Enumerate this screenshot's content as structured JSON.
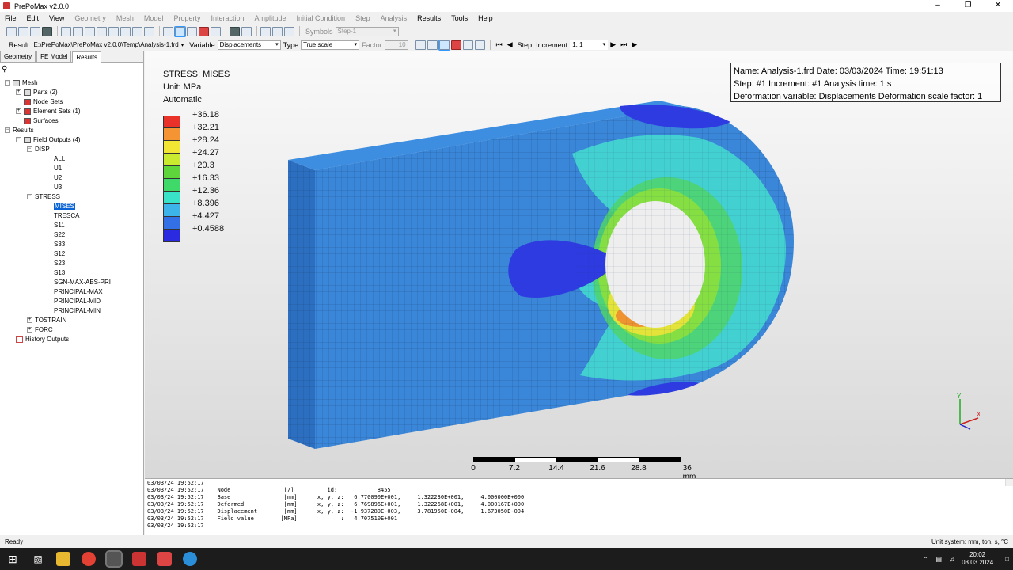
{
  "window": {
    "title": "PrePoMax v2.0.0"
  },
  "menu": [
    "File",
    "Edit",
    "View",
    "Geometry",
    "Mesh",
    "Model",
    "Property",
    "Interaction",
    "Amplitude",
    "Initial Condition",
    "Step",
    "Analysis",
    "Results",
    "Tools",
    "Help"
  ],
  "toolbar1": {
    "symbols_label": "Symbols",
    "step_value": "Step-1"
  },
  "toolbar2": {
    "result_label": "Result",
    "result_path": "E:\\PrePoMax\\PrePoMax v2.0.0\\Temp\\Analysis-1.frd",
    "variable_label": "Variable",
    "variable_value": "Displacements",
    "type_label": "Type",
    "type_value": "True scale",
    "factor_label": "Factor",
    "factor_value": "10",
    "step_increment_label": "Step, Increment",
    "step_increment_value": "1, 1"
  },
  "tabs": [
    "Geometry",
    "FE Model",
    "Results"
  ],
  "tree": {
    "mesh": "Mesh",
    "parts": "Parts (2)",
    "node_sets": "Node Sets",
    "element_sets": "Element Sets (1)",
    "surfaces": "Surfaces",
    "results": "Results",
    "field_outputs": "Field Outputs (4)",
    "disp": "DISP",
    "disp_items": [
      "ALL",
      "U1",
      "U2",
      "U3"
    ],
    "stress": "STRESS",
    "stress_items": [
      "MISES",
      "TRESCA",
      "S11",
      "S22",
      "S33",
      "S12",
      "S23",
      "S13",
      "SGN-MAX-ABS-PRI",
      "PRINCIPAL-MAX",
      "PRINCIPAL-MID",
      "PRINCIPAL-MIN"
    ],
    "tostrain": "TOSTRAIN",
    "forc": "FORC",
    "history_outputs": "History Outputs"
  },
  "legend": {
    "title": "STRESS: MISES",
    "unit": "Unit: MPa",
    "mode": "Automatic",
    "values": [
      "+36.18",
      "+32.21",
      "+28.24",
      "+24.27",
      "+20.3",
      "+16.33",
      "+12.36",
      "+8.396",
      "+4.427",
      "+0.4588"
    ],
    "colors": [
      "#e8322a",
      "#f49433",
      "#f2e533",
      "#c9ea2e",
      "#5ed63b",
      "#3fd96a",
      "#39e3c8",
      "#3cb4ea",
      "#3370e6",
      "#2a2ae0"
    ]
  },
  "info": {
    "line1": "Name: Analysis-1.frd   Date: 03/03/2024   Time: 19:51:13",
    "line2": "Step: #1   Increment: #1   Analysis time: 1 s",
    "line3": "Deformation variable: Displacements   Deformation scale factor: 1"
  },
  "scale": {
    "ticks": [
      "0",
      "7.2",
      "14.4",
      "21.6",
      "28.8",
      "36 mm"
    ]
  },
  "axes": {
    "y": "Y",
    "x": "X"
  },
  "console": [
    "03/03/24 19:52:17",
    "03/03/24 19:52:17    Node                [/]          id:            8455",
    "03/03/24 19:52:17    Base                [mm]      x, y, z:   6.770090E+001,     1.322230E+001,     4.000000E+000",
    "03/03/24 19:52:17    Deformed            [mm]      x, y, z:   6.769896E+001,     1.322268E+001,     4.000167E+000",
    "03/03/24 19:52:17    Displacement        [mm]      x, y, z:  -1.937280E-003,     3.781950E-004,     1.673050E-004",
    "03/03/24 19:52:17    Field value        [MPa]             :   4.707510E+001",
    "03/03/24 19:52:17"
  ],
  "status": {
    "left": "Ready",
    "right": "Unit system: mm, ton, s, °C"
  },
  "taskbar": {
    "time": "20:02",
    "date": "03.03.2024"
  }
}
